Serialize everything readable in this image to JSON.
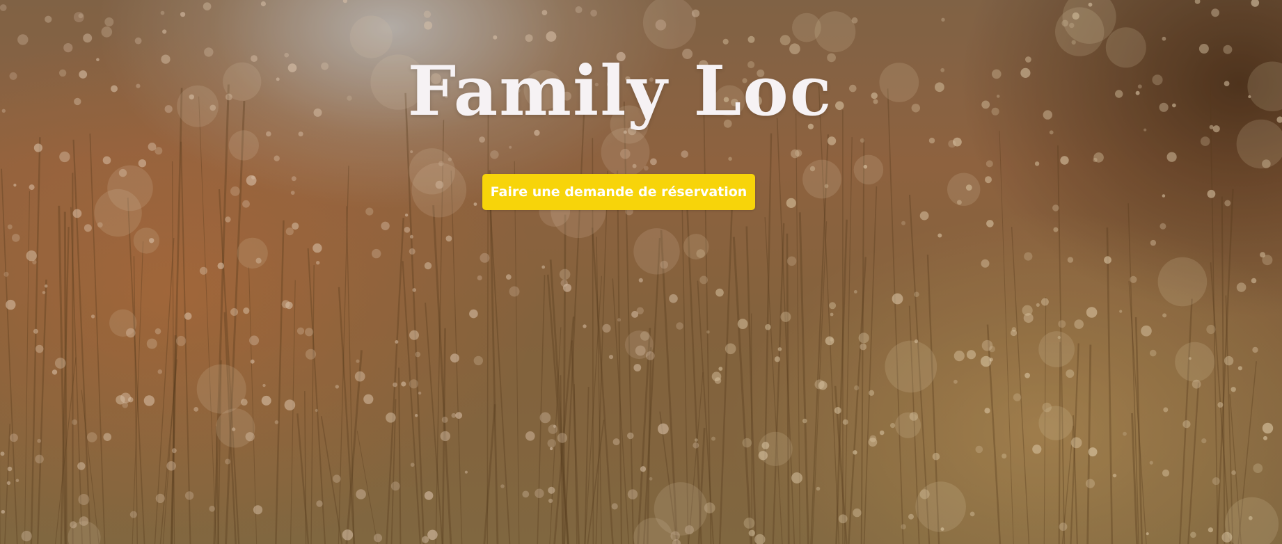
{
  "hero": {
    "title": "Family Loc",
    "cta_label": "Faire une demande de réservation",
    "background_image": "golden-meadow-grass-photo"
  },
  "colors": {
    "cta_background": "#f7d40a",
    "cta_text": "#ffffff",
    "title_text": "#f6f2f4"
  }
}
